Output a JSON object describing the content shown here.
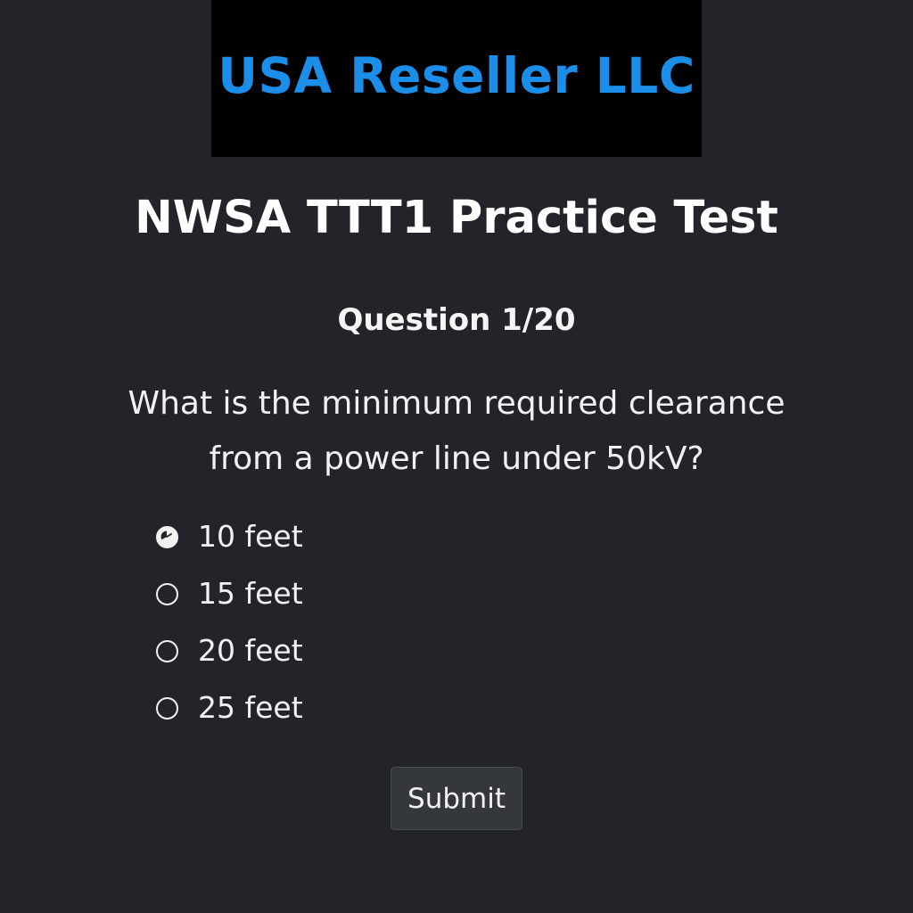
{
  "logo": {
    "text": "USA Reseller LLC",
    "color": "#1a8ee8",
    "background": "#000000"
  },
  "page_title": "NWSA TTT1 Practice Test",
  "question": {
    "counter": "Question 1/20",
    "text": "What is the minimum required clearance from a power line under 50kV?",
    "options": [
      {
        "label": "10 feet",
        "selected": true
      },
      {
        "label": "15 feet",
        "selected": false
      },
      {
        "label": "20 feet",
        "selected": false
      },
      {
        "label": "25 feet",
        "selected": false
      }
    ]
  },
  "submit_label": "Submit",
  "colors": {
    "background": "#222429",
    "text": "#f2f2f2",
    "button_bg": "#34373c"
  }
}
